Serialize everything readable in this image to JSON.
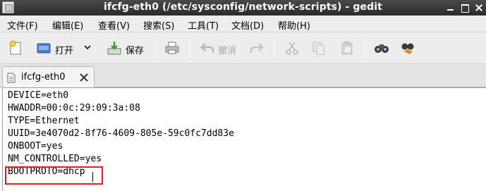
{
  "window": {
    "title": "ifcfg-eth0 (/etc/sysconfig/network-scripts) - gedit"
  },
  "menu": [
    {
      "label": "文件(F)"
    },
    {
      "label": "编辑(E)"
    },
    {
      "label": "查看(V)"
    },
    {
      "label": "搜索(S)"
    },
    {
      "label": "工具(T)"
    },
    {
      "label": "文档(D)"
    },
    {
      "label": "帮助(H)"
    }
  ],
  "toolbar": {
    "open_label": "打开",
    "save_label": "保存",
    "undo_label": "撤消"
  },
  "tab": {
    "label": "ifcfg-eth0"
  },
  "editor": {
    "lines": [
      "DEVICE=eth0",
      "HWADDR=00:0c:29:09:3a:08",
      "TYPE=Ethernet",
      "UUID=3e4070d2-8f76-4609-805e-59c0fc7dd83e",
      "ONBOOT=yes",
      "NM_CONTROLLED=yes",
      "BOOTPROTO=dhcp"
    ]
  },
  "colors": {
    "titlebar": "#2f2f2f",
    "highlight": "#e02020"
  }
}
